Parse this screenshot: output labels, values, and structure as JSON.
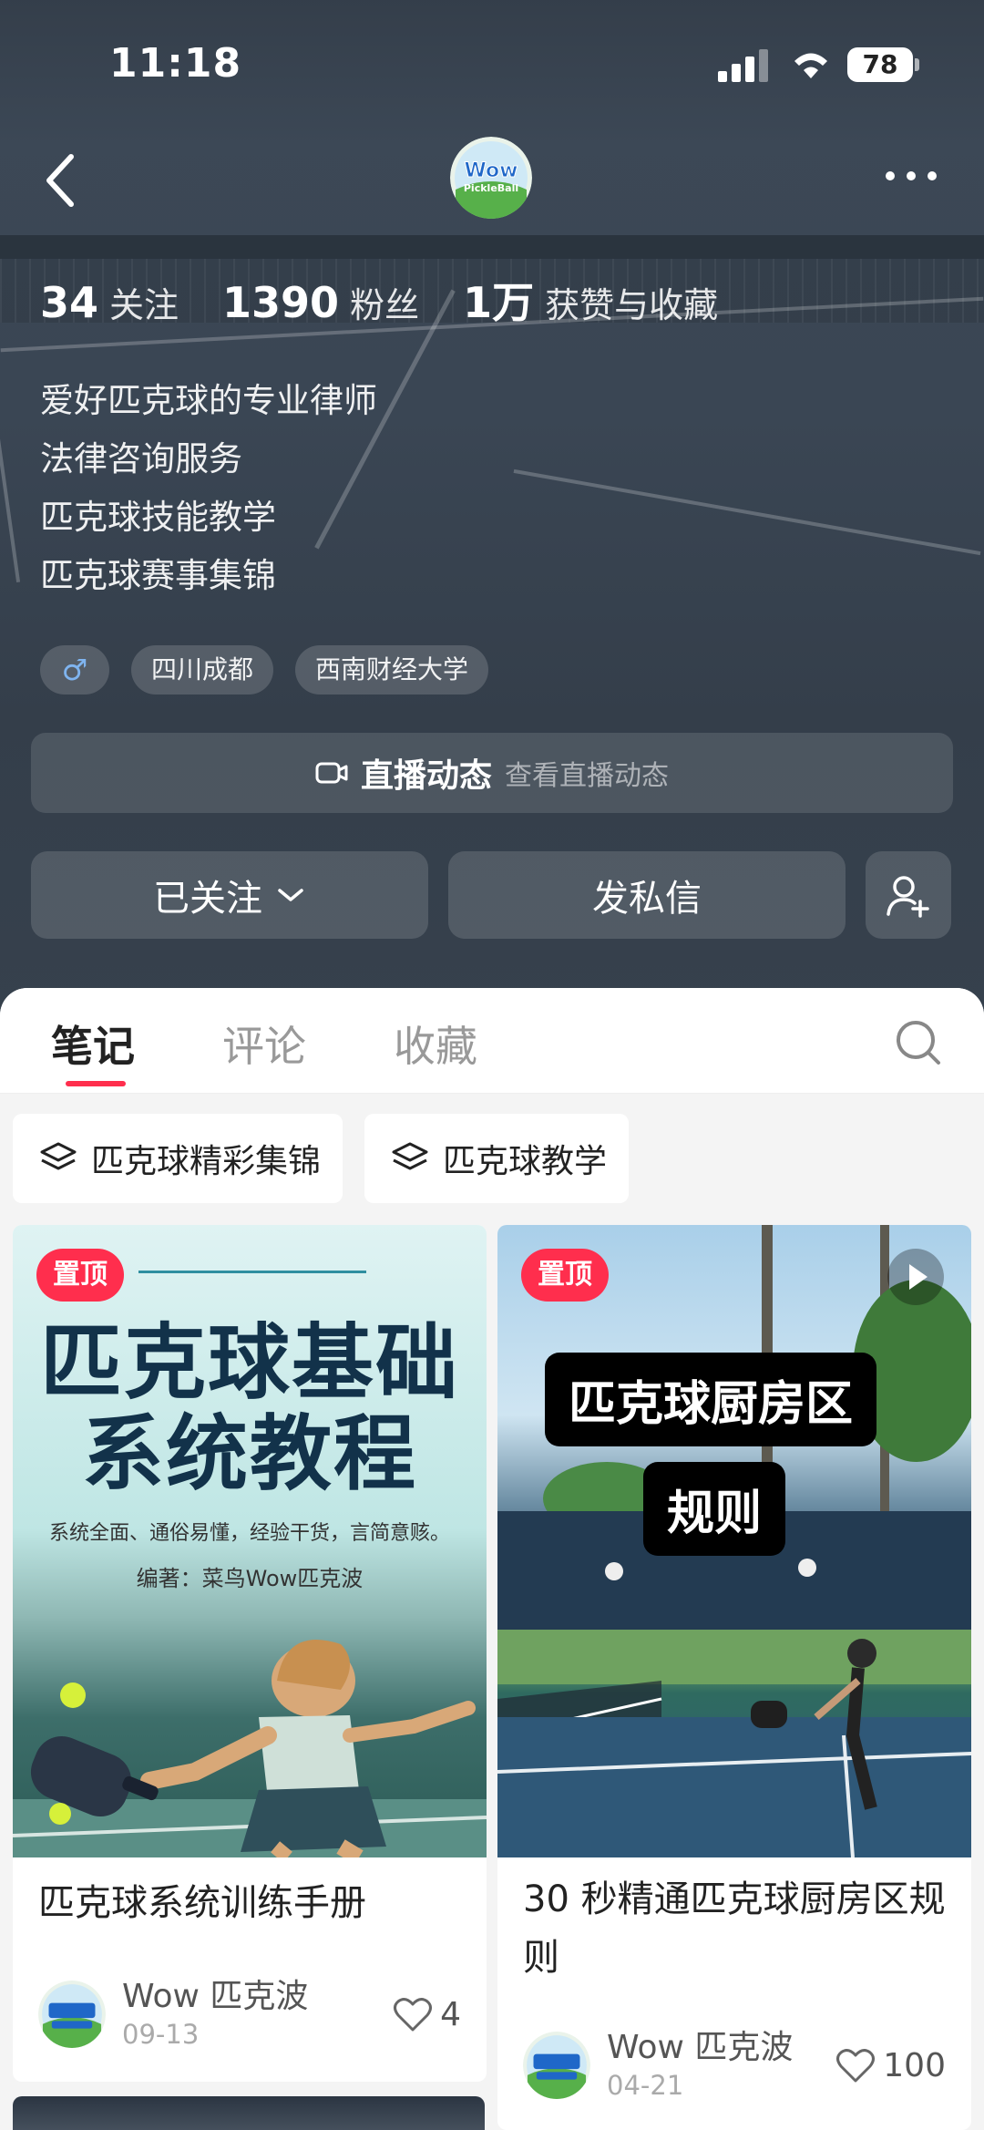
{
  "status": {
    "time": "11:18",
    "battery": "78"
  },
  "header": {
    "avatar_text_1": "Wow",
    "avatar_text_2": "PickleBall"
  },
  "stats": [
    {
      "num": "34",
      "label": "关注"
    },
    {
      "num": "1390",
      "label": "粉丝"
    },
    {
      "num": "1万",
      "label": "获赞与收藏"
    }
  ],
  "bio": [
    "爱好匹克球的专业律师",
    "法律咨询服务",
    "匹克球技能教学",
    "匹克球赛事集锦"
  ],
  "tags": {
    "gender": "♂",
    "location": "四川成都",
    "school": "西南财经大学"
  },
  "live": {
    "title": "直播动态",
    "subtitle": "查看直播动态"
  },
  "actions": {
    "follow": "已关注",
    "message": "发私信"
  },
  "tabs": {
    "notes": "笔记",
    "comments": "评论",
    "favorites": "收藏"
  },
  "collections": [
    "匹克球精彩集锦",
    "匹克球教学"
  ],
  "cards": [
    {
      "pin": "置顶",
      "cover_title_1": "匹克球基础",
      "cover_title_2": "系统教程",
      "cover_sub": "系统全面、通俗易懂，经验干货，言简意赅。",
      "cover_author": "编著：菜鸟Wow匹克波",
      "title": "匹克球系统训练手册",
      "author": "Wow 匹克波",
      "date": "09-13",
      "likes": "4"
    },
    {
      "pin": "置顶",
      "cover_caption_1": "匹克球厨房区",
      "cover_caption_2": "规则",
      "title": "30 秒精通匹克球厨房区规则",
      "author": "Wow 匹克波",
      "date": "04-21",
      "likes": "100"
    }
  ],
  "colors": {
    "accent": "#ff2e4d",
    "header_bg": "#36414d",
    "gender_blue": "#7fb4ef"
  }
}
